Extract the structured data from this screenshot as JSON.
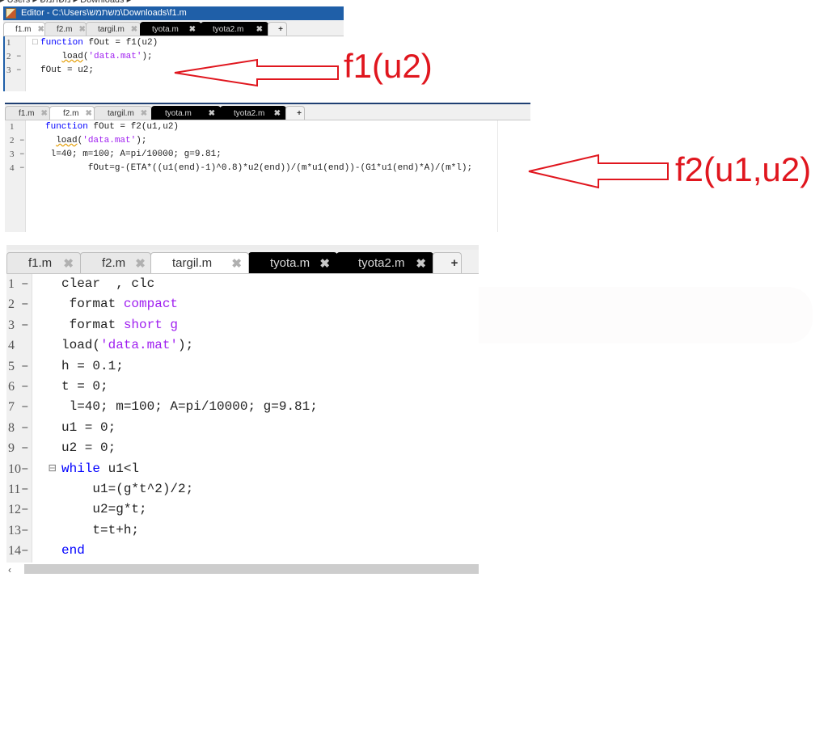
{
  "breadcrumb": {
    "path": "▸ Users ▸ משתמש ▸ Downloads ▸"
  },
  "panel1": {
    "window_title": "Editor - C:\\Users\\משתמש\\Downloads\\f1.m",
    "tabs": [
      {
        "label": "f1.m",
        "active": true
      },
      {
        "label": "f2.m",
        "active": false
      },
      {
        "label": "targil.m",
        "active": false
      },
      {
        "label": "tyota.m",
        "active": false
      },
      {
        "label": "tyota2.m",
        "active": false
      }
    ],
    "add_tab_label": "+",
    "close_glyph": "✖",
    "lines": [
      {
        "num": "1",
        "dash": "",
        "fold": "□",
        "parts": [
          {
            "t": "function",
            "c": "kw"
          },
          {
            "t": " fOut = f1(u2)",
            "c": ""
          }
        ]
      },
      {
        "num": "2",
        "dash": "–",
        "fold": "",
        "parts": [
          {
            "t": "    ",
            "c": ""
          },
          {
            "t": "load",
            "c": "squig"
          },
          {
            "t": "(",
            "c": ""
          },
          {
            "t": "'data.mat'",
            "c": "str"
          },
          {
            "t": ");",
            "c": ""
          }
        ]
      },
      {
        "num": "3",
        "dash": "–",
        "fold": "",
        "parts": [
          {
            "t": "fOut = u2;",
            "c": ""
          }
        ]
      }
    ]
  },
  "panel2": {
    "tabs": [
      {
        "label": "f1.m",
        "active": false
      },
      {
        "label": "f2.m",
        "active": true
      },
      {
        "label": "targil.m",
        "active": false
      },
      {
        "label": "tyota.m",
        "active": false
      },
      {
        "label": "tyota2.m",
        "active": false
      }
    ],
    "add_tab_label": "+",
    "close_glyph": "✖",
    "lines": [
      {
        "num": "1",
        "dash": "",
        "parts": [
          {
            "t": "function",
            "c": "kw"
          },
          {
            "t": " fOut = f2(u1,u2)",
            "c": ""
          }
        ]
      },
      {
        "num": "2",
        "dash": "–",
        "parts": [
          {
            "t": "  ",
            "c": ""
          },
          {
            "t": "load",
            "c": "squig"
          },
          {
            "t": "(",
            "c": ""
          },
          {
            "t": "'data.mat'",
            "c": "str"
          },
          {
            "t": ");",
            "c": ""
          }
        ]
      },
      {
        "num": "3",
        "dash": "–",
        "parts": [
          {
            "t": " l=40; m=100; A=pi/10000; g=9.81;",
            "c": ""
          }
        ]
      },
      {
        "num": "4",
        "dash": "–",
        "parts": [
          {
            "t": "        fOut=g-(ETA*((u1(end)-1)^0.8)*u2(end))/(m*u1(end))-(G1*u1(end)*A)/(m*l);",
            "c": ""
          }
        ]
      }
    ]
  },
  "panel3": {
    "tabs": [
      {
        "label": "f1.m",
        "active": false
      },
      {
        "label": "f2.m",
        "active": false
      },
      {
        "label": "targil.m",
        "active": true
      },
      {
        "label": "tyota.m",
        "active": false
      },
      {
        "label": "tyota2.m",
        "active": false
      }
    ],
    "add_tab_label": "+",
    "close_glyph": "✖",
    "scroll_left_glyph": "‹",
    "lines": [
      {
        "num": "1",
        "dash": "–",
        "parts": [
          {
            "t": "clear  , clc",
            "c": ""
          }
        ]
      },
      {
        "num": "2",
        "dash": "–",
        "parts": [
          {
            "t": " format ",
            "c": ""
          },
          {
            "t": "compact",
            "c": "str"
          }
        ]
      },
      {
        "num": "3",
        "dash": "–",
        "parts": [
          {
            "t": " format ",
            "c": ""
          },
          {
            "t": "short g",
            "c": "str"
          }
        ]
      },
      {
        "num": "4",
        "dash": "",
        "parts": [
          {
            "t": "load(",
            "c": ""
          },
          {
            "t": "'data.mat'",
            "c": "str"
          },
          {
            "t": ");",
            "c": ""
          }
        ]
      },
      {
        "num": "5",
        "dash": "–",
        "parts": [
          {
            "t": "h = 0.1;",
            "c": ""
          }
        ]
      },
      {
        "num": "6",
        "dash": "–",
        "parts": [
          {
            "t": "t = 0;",
            "c": ""
          }
        ]
      },
      {
        "num": "7",
        "dash": "–",
        "parts": [
          {
            "t": " l=40; m=100; A=pi/10000; g=9.81;",
            "c": ""
          }
        ]
      },
      {
        "num": "8",
        "dash": "–",
        "parts": [
          {
            "t": "u1 = 0;",
            "c": ""
          }
        ]
      },
      {
        "num": "9",
        "dash": "–",
        "parts": [
          {
            "t": "u2 = 0;",
            "c": ""
          }
        ]
      },
      {
        "num": "10",
        "dash": "–",
        "fold": "⊟",
        "parts": [
          {
            "t": "while",
            "c": "kw"
          },
          {
            "t": " u1<l",
            "c": ""
          }
        ]
      },
      {
        "num": "11",
        "dash": "–",
        "parts": [
          {
            "t": "    u1=(g*t^2)/2;",
            "c": ""
          }
        ]
      },
      {
        "num": "12",
        "dash": "–",
        "parts": [
          {
            "t": "    u2=g*t;",
            "c": ""
          }
        ]
      },
      {
        "num": "13",
        "dash": "–",
        "parts": [
          {
            "t": "    t=t+h;",
            "c": ""
          }
        ]
      },
      {
        "num": "14",
        "dash": "–",
        "parts": [
          {
            "t": "end",
            "c": "kw"
          }
        ]
      }
    ]
  },
  "annotations": {
    "label1": "f1(u2)",
    "label2": "f2(u1,u2)",
    "color": "#e0161e"
  }
}
